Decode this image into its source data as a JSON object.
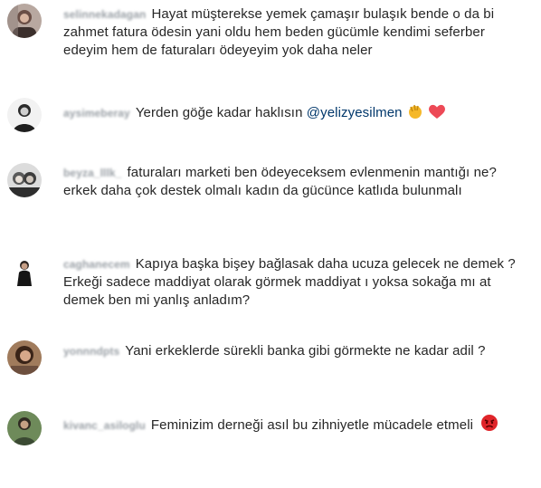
{
  "comments": [
    {
      "username": "selinnekadagan",
      "text": "Hayat müşterekse yemek çamaşır bulaşık bende o da bi zahmet fatura ödesin yani oldu hem beden gücümle kendimi seferber edeyim hem de faturaları ödeyeyim yok daha neler",
      "avatar_icon": "user-photo-icon"
    },
    {
      "username": "aysimeberay",
      "text": "Yerden göğe kadar haklısın",
      "mention": "@yelizyesilmen",
      "emojis": [
        "clapping-hands-icon",
        "red-heart-icon"
      ],
      "avatar_icon": "user-photo-icon"
    },
    {
      "username": "beyza_lllk_",
      "text": "faturaları marketi ben ödeyeceksem evlenmenin mantığı ne? erkek daha çok destek olmalı kadın da gücünce katlıda bulunmalı",
      "avatar_icon": "user-photo-icon"
    },
    {
      "username": "caghanecem",
      "text": "Kapıya başka bişey bağlasak daha ucuza gelecek ne demek ? Erkeği sadece maddiyat olarak görmek maddiyat ı yoksa sokağa mı at demek ben mi yanlış anladım?",
      "avatar_icon": "user-photo-icon"
    },
    {
      "username": "yonnndpts",
      "text": "Yani erkeklerde sürekli banka gibi görmekte ne kadar adil ?",
      "avatar_icon": "user-photo-icon"
    },
    {
      "username": "kivanc_asiloglu",
      "text": "Feminizim derneği asıl bu zihniyetle mücadele etmeli",
      "emojis": [
        "angry-face-icon"
      ],
      "avatar_icon": "user-photo-icon"
    }
  ],
  "colors": {
    "text": "#262626",
    "username": "#9aa0a6",
    "mention": "#00376b",
    "heart": "#ed4956",
    "clap": "#f5b829",
    "angry": "#e0252a"
  }
}
